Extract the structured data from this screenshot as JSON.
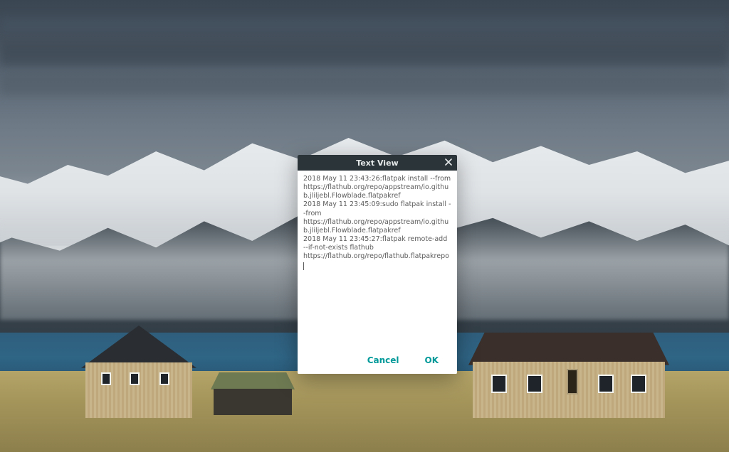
{
  "dialog": {
    "title": "Text View",
    "close_icon": "close-icon",
    "text_content": "2018 May 11 23:43:26:flatpak install --from https://flathub.org/repo/appstream/io.github.jliljebl.Flowblade.flatpakref\n2018 May 11 23:45:09:sudo flatpak install --from https://flathub.org/repo/appstream/io.github.jliljebl.Flowblade.flatpakref\n2018 May 11 23:45:27:flatpak remote-add --if-not-exists flathub https://flathub.org/repo/flathub.flatpakrepo\n",
    "buttons": {
      "cancel": "Cancel",
      "ok": "OK"
    }
  },
  "colors": {
    "accent": "#009999",
    "titlebar": "#2b3438"
  }
}
